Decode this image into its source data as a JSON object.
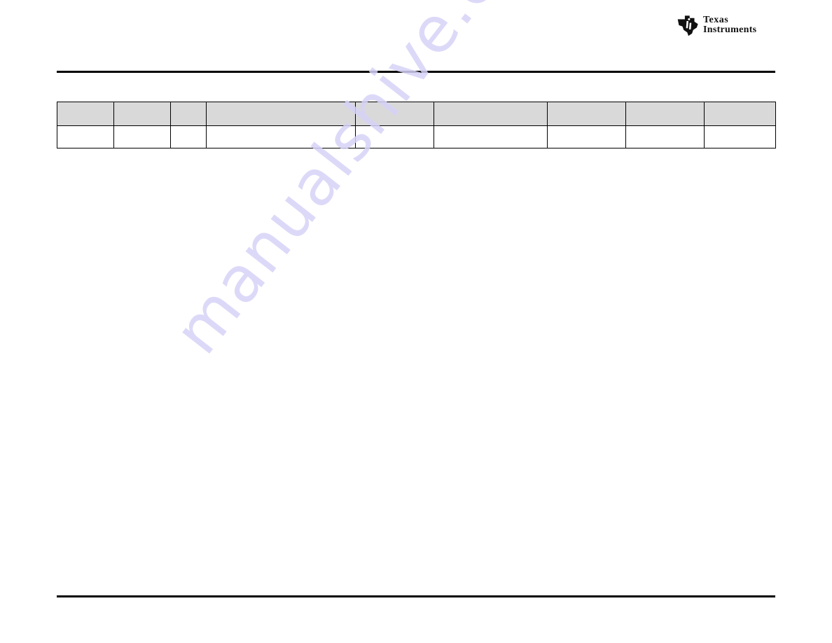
{
  "header": {
    "logo": {
      "icon": "texas-state-ti-logo-icon",
      "line1": "Texas",
      "line2": "Instruments"
    }
  },
  "table": {
    "columns": [
      "",
      "",
      "",
      "",
      "",
      "",
      "",
      "",
      ""
    ],
    "rows": [
      [
        "",
        "",
        "",
        "",
        "",
        "",
        "",
        "",
        ""
      ]
    ]
  },
  "watermark": {
    "text": "manualshive.com",
    "color": "#d6d3f7"
  }
}
